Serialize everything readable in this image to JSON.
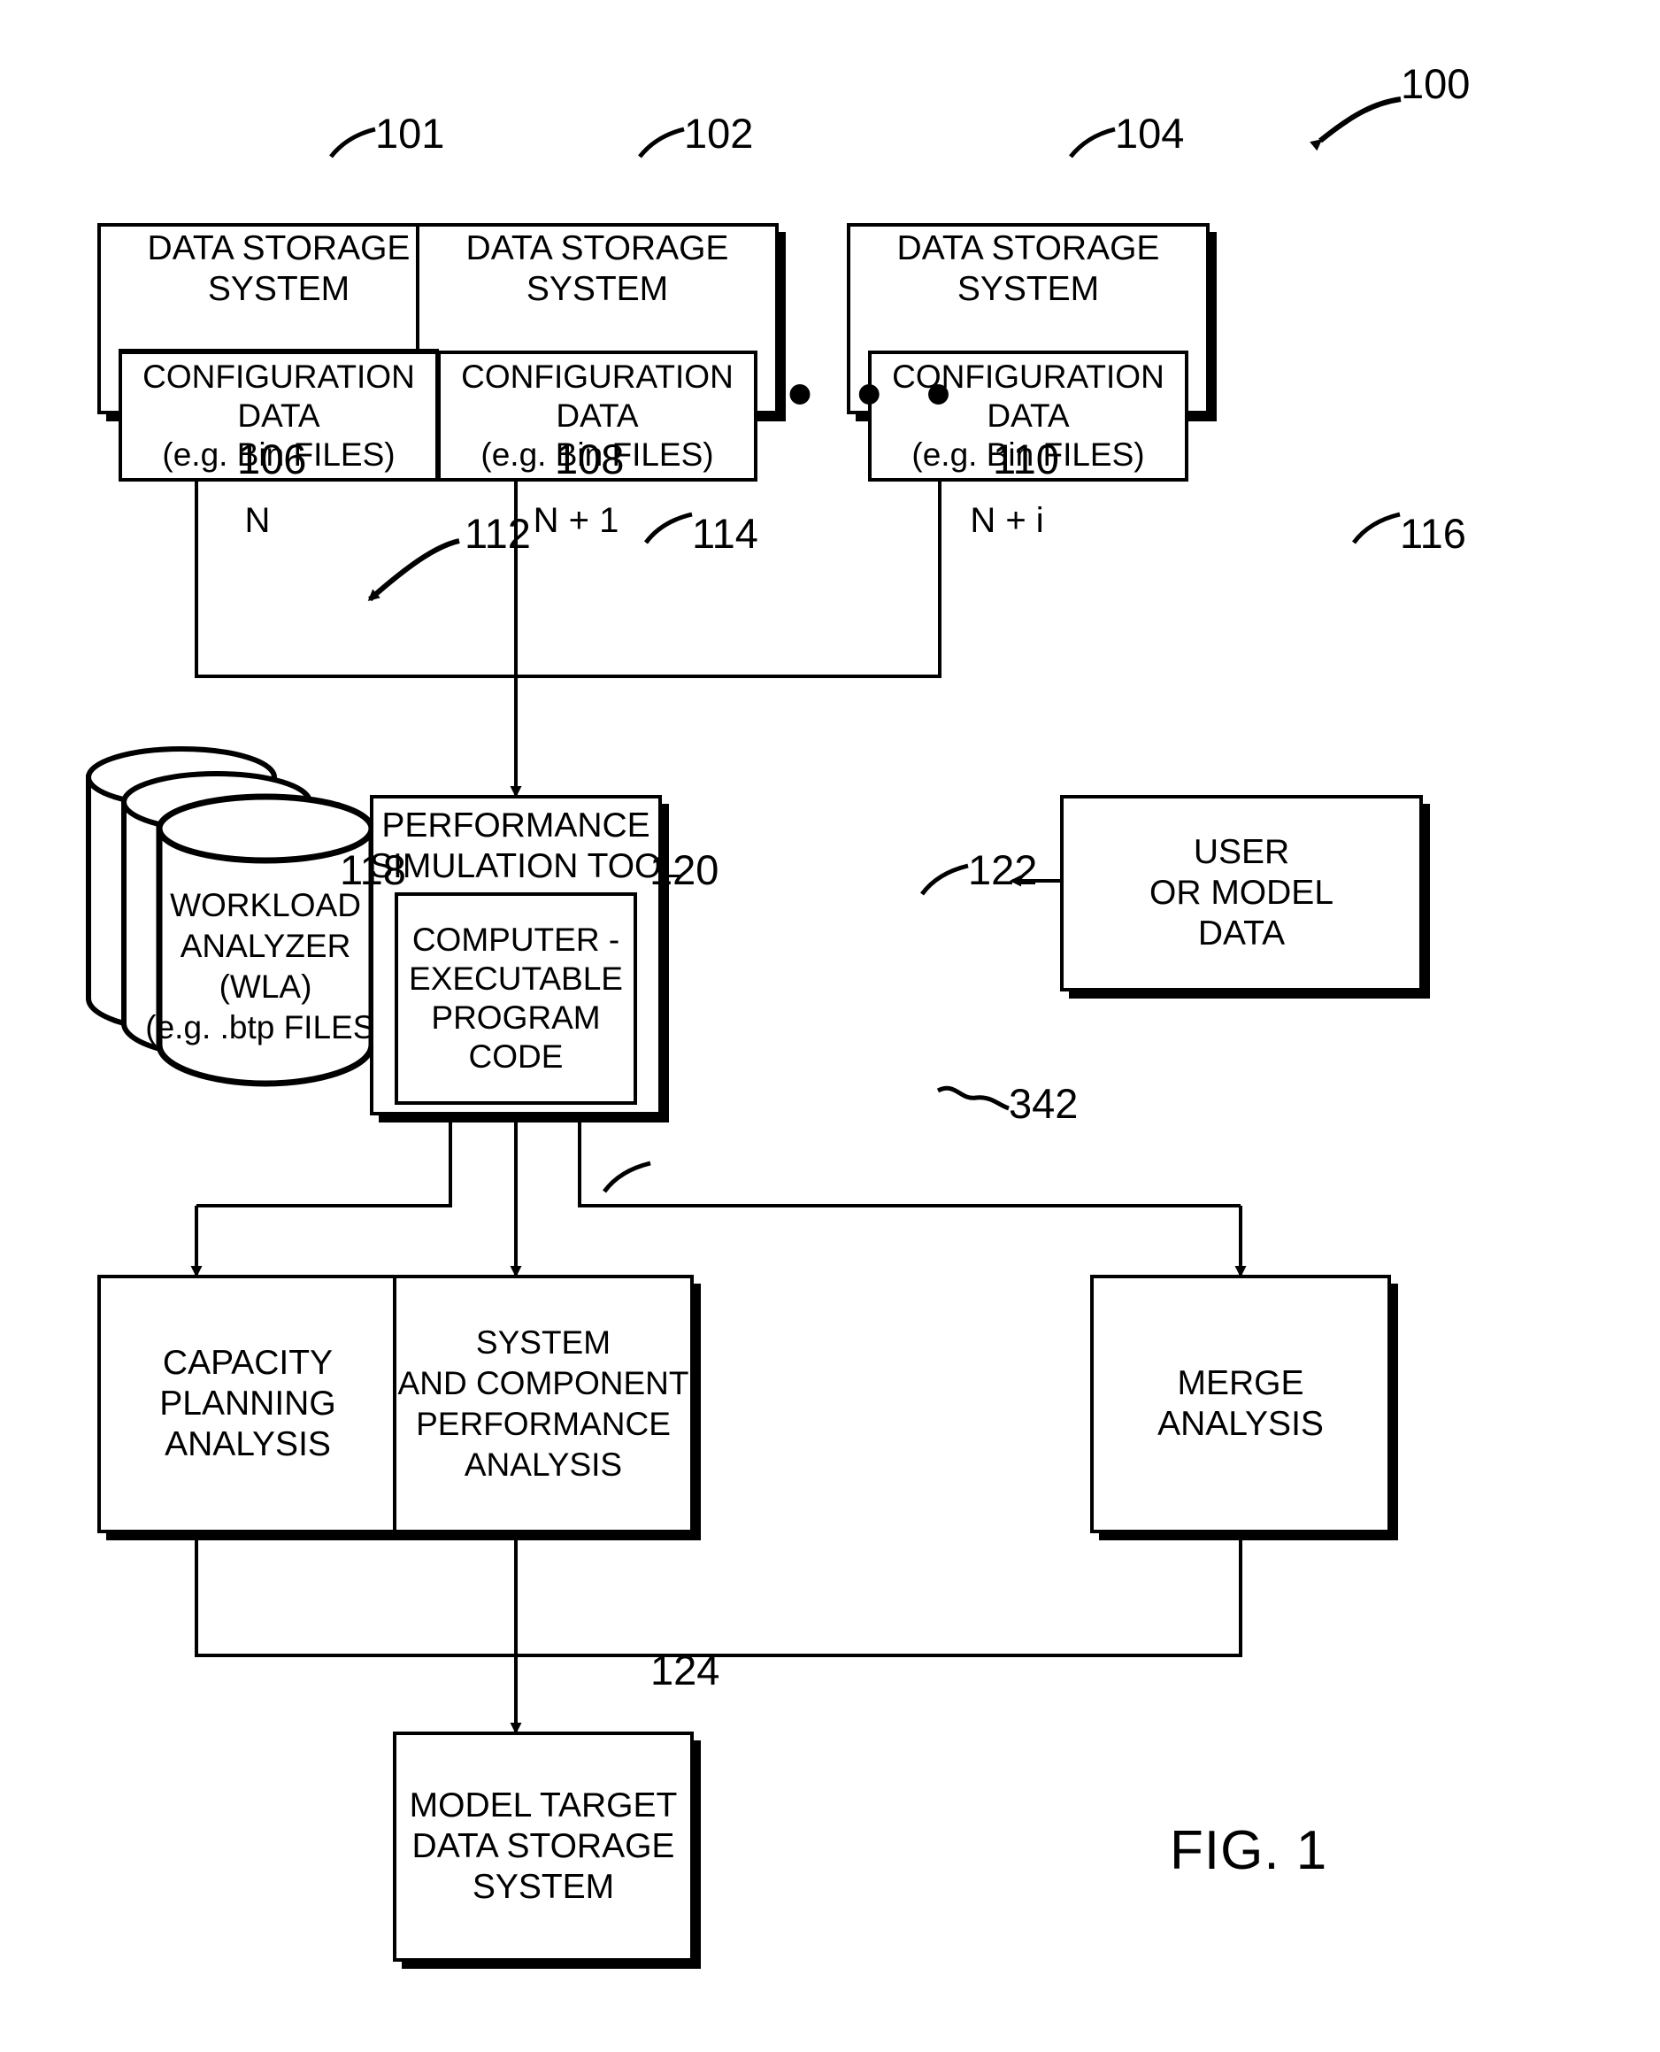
{
  "figure": {
    "label": "FIG. 1",
    "system_ref": "100"
  },
  "storage_systems": [
    {
      "ref": "101",
      "title_line1": "DATA STORAGE",
      "title_line2": "SYSTEM",
      "config_line1": "CONFIGURATION",
      "config_line2": "DATA",
      "config_line3": "(e.g. Bin FILES)",
      "index": "N",
      "link_ref": "106"
    },
    {
      "ref": "102",
      "title_line1": "DATA STORAGE",
      "title_line2": "SYSTEM",
      "config_line1": "CONFIGURATION",
      "config_line2": "DATA",
      "config_line3": "(e.g. Bin FILES)",
      "index": "N + 1",
      "link_ref": "108"
    },
    {
      "ref": "104",
      "title_line1": "DATA STORAGE",
      "title_line2": "SYSTEM",
      "config_line1": "CONFIGURATION",
      "config_line2": "DATA",
      "config_line3": "(e.g. Bin FILES)",
      "index": "N + i",
      "link_ref": "110"
    }
  ],
  "ellipsis": "• • •",
  "workload_analyzer": {
    "ref": "112",
    "line1": "WORKLOAD",
    "line2": "ANALYZER",
    "line3": "(WLA)",
    "line4": "(e.g. .btp FILES)"
  },
  "simulation_tool": {
    "ref": "114",
    "title_line1": "PERFORMANCE",
    "title_line2": "SIMULATION TOOL",
    "code_ref": "342",
    "code_line1": "COMPUTER -",
    "code_line2": "EXECUTABLE",
    "code_line3": "PROGRAM",
    "code_line4": "CODE"
  },
  "user_model_data": {
    "ref": "116",
    "line1": "USER",
    "line2": "OR MODEL",
    "line3": "DATA"
  },
  "analyses": [
    {
      "ref": "118",
      "lines": [
        "CAPACITY",
        "PLANNING",
        "ANALYSIS"
      ]
    },
    {
      "ref": "120",
      "lines": [
        "SYSTEM",
        "AND COMPONENT",
        "PERFORMANCE",
        "ANALYSIS"
      ]
    },
    {
      "ref": "122",
      "lines": [
        "MERGE",
        "ANALYSIS"
      ]
    }
  ],
  "model_target": {
    "ref": "124",
    "line1": "MODEL TARGET",
    "line2": "DATA STORAGE",
    "line3": "SYSTEM"
  }
}
